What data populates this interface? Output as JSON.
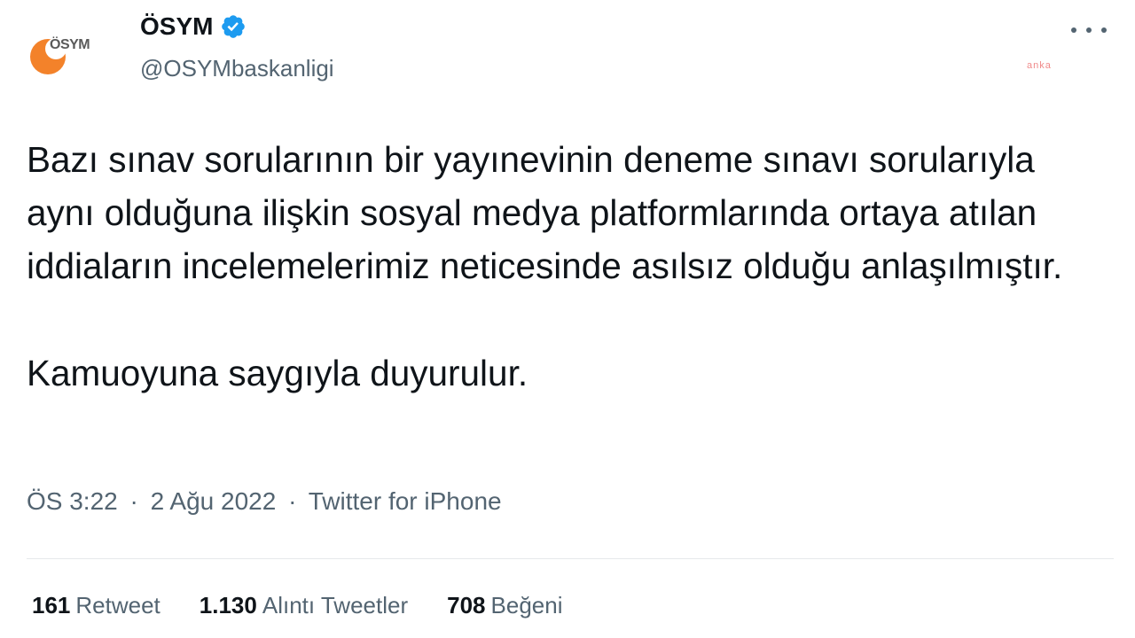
{
  "author": {
    "logo_text": "ÖSYM",
    "display_name": "ÖSYM",
    "handle": "@OSYMbaskanligi",
    "verified": true,
    "logo_colors": {
      "circle": "#f3822a",
      "text": "#5a5a5a"
    }
  },
  "icons": {
    "verified": "verified-badge-icon",
    "more": "more-options-icon"
  },
  "tweet": {
    "paragraph1": "Bazı sınav sorularının bir yayınevinin deneme sınavı sorularıyla aynı olduğuna ilişkin sosyal medya platformlarında ortaya atılan iddiaların incelemelerimiz neticesinde asılsız olduğu anlaşılmıştır.",
    "paragraph2": "Kamuoyuna saygıyla duyurulur."
  },
  "meta": {
    "time": "ÖS 3:22",
    "separator": "·",
    "date": "2 Ağu 2022",
    "source": "Twitter for iPhone"
  },
  "stats": {
    "retweets": {
      "count": "161",
      "label": "Retweet"
    },
    "quotes": {
      "count": "1.130",
      "label": "Alıntı Tweetler"
    },
    "likes": {
      "count": "708",
      "label": "Beğeni"
    }
  },
  "watermark": "anka",
  "colors": {
    "text": "#0f1419",
    "secondary": "#536471",
    "verified": "#1d9bf0",
    "divider": "#e6e9eb"
  }
}
